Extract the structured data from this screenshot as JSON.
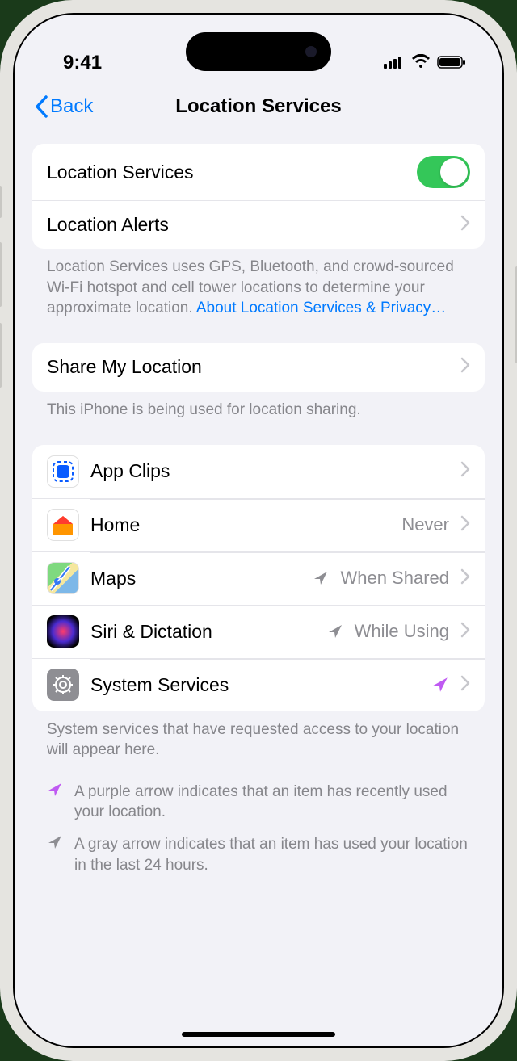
{
  "status": {
    "time": "9:41"
  },
  "nav": {
    "back": "Back",
    "title": "Location Services"
  },
  "group1": {
    "locationServices": "Location Services",
    "locationAlerts": "Location Alerts",
    "footer_a": "Location Services uses GPS, Bluetooth, and crowd-sourced Wi-Fi hotspot and cell tower locations to determine your approximate location. ",
    "footer_link": "About Location Services & Privacy…"
  },
  "group2": {
    "shareMyLocation": "Share My Location",
    "footer": "This iPhone is being used for location sharing."
  },
  "apps": {
    "items": [
      {
        "label": "App Clips",
        "status": "",
        "indicator": "none",
        "icon": "appclips"
      },
      {
        "label": "Home",
        "status": "Never",
        "indicator": "none",
        "icon": "home"
      },
      {
        "label": "Maps",
        "status": "When Shared",
        "indicator": "gray",
        "icon": "maps"
      },
      {
        "label": "Siri & Dictation",
        "status": "While Using",
        "indicator": "gray",
        "icon": "siri"
      },
      {
        "label": "System Services",
        "status": "",
        "indicator": "purple",
        "icon": "settings"
      }
    ],
    "footer": "System services that have requested access to your location will appear here."
  },
  "legend": {
    "purple": "A purple arrow indicates that an item has recently used your location.",
    "gray": "A gray arrow indicates that an item has used your location in the last 24 hours."
  },
  "colors": {
    "purple": "#bf5af2",
    "gray": "#8e8e93",
    "link": "#007aff",
    "toggleOn": "#34c759"
  }
}
